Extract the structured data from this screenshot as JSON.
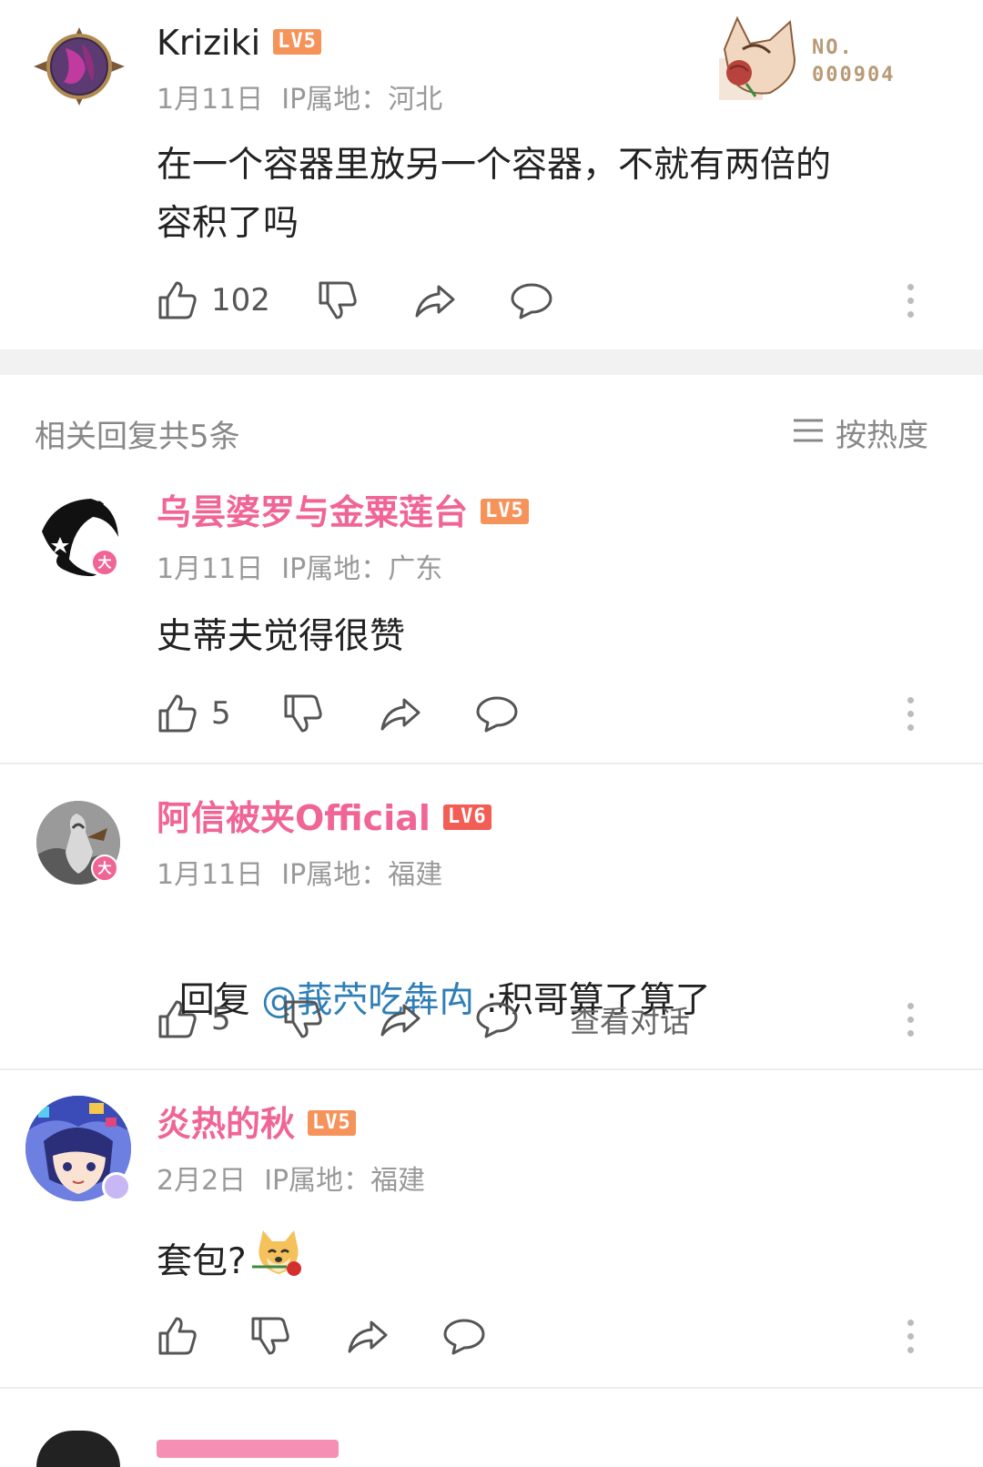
{
  "main_comment": {
    "username": "Kriziki",
    "level": "LV5",
    "date": "1月11日",
    "ip": "IP属地：河北",
    "content_line1": "在一个容器里放另一个容器，不就有两倍的",
    "content_line2": "容积了吗",
    "likes": "102",
    "sticker_no_label": "NO.",
    "sticker_no_value": "000904"
  },
  "replies_header": {
    "title": "相关回复共5条",
    "sort_label": "按热度"
  },
  "replies": [
    {
      "username": "乌昙婆罗与金粟莲台",
      "level": "LV5",
      "date": "1月11日",
      "ip": "IP属地：广东",
      "content": "史蒂夫觉得很赞",
      "likes": "5",
      "badge_char": "大"
    },
    {
      "username": "阿信被夹Official",
      "level": "LV6",
      "date": "1月11日",
      "ip": "IP属地：福建",
      "reply_prefix": "回复 ",
      "mention": "@莪茓吃犇禸",
      "content": " :积哥算了算了",
      "likes": "5",
      "view_conversation": "查看对话",
      "badge_char": "大"
    },
    {
      "username": "炎热的秋",
      "level": "LV5",
      "date": "2月2日",
      "ip": "IP属地：福建",
      "content": "套包?",
      "likes": ""
    }
  ],
  "colors": {
    "username_pink": "#f06595",
    "lv5": "#f5935a",
    "lv6": "#f25d55",
    "mention": "#2f7fb6",
    "meta_gray": "#999999"
  },
  "icons": [
    "thumb-up-icon",
    "thumb-down-icon",
    "share-icon",
    "comment-icon",
    "more-icon",
    "sort-icon"
  ]
}
